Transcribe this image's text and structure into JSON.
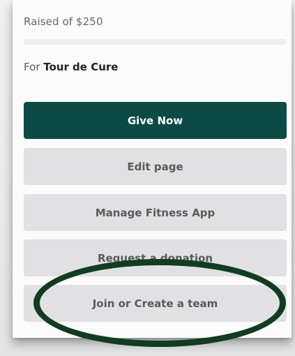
{
  "summary": {
    "raised_text": "Raised of $250",
    "progress_fraction": 0,
    "for_prefix": "For",
    "event_name": "Tour de Cure"
  },
  "actions": {
    "give_now": "Give Now",
    "edit_page": "Edit page",
    "manage_fitness_app": "Manage Fitness App",
    "request_donation": "Request a donation",
    "join_create_team": "Join or Create a team"
  },
  "colors": {
    "primary": "#0b4a45",
    "secondary_button": "#e1e1e3",
    "annotation": "#103c22"
  }
}
